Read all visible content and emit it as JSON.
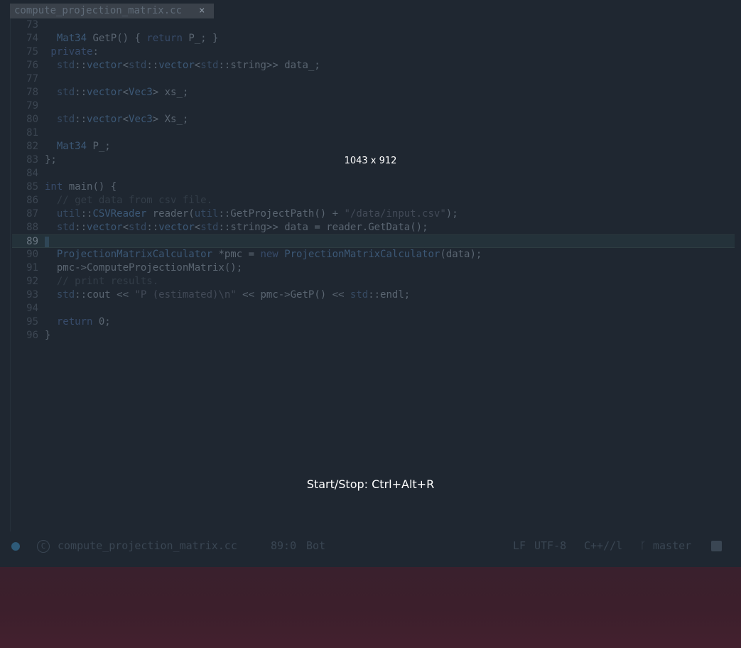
{
  "tab": {
    "title": "compute_projection_matrix.cc",
    "close": "×"
  },
  "overlay": {
    "dimensions": "1043 x 912",
    "hint": "Start/Stop: Ctrl+Alt+R"
  },
  "code_lines": [
    {
      "n": "73",
      "segs": []
    },
    {
      "n": "74",
      "segs": [
        [
          "t",
          "  "
        ],
        [
          "ty",
          "Mat34"
        ],
        [
          "t",
          " GetP() { "
        ],
        [
          "kw",
          "return"
        ],
        [
          "t",
          " P_; }"
        ]
      ]
    },
    {
      "n": "75",
      "segs": [
        [
          "kw",
          " private"
        ],
        [
          "t",
          ":"
        ]
      ]
    },
    {
      "n": "76",
      "segs": [
        [
          "t",
          "  "
        ],
        [
          "ns",
          "std"
        ],
        [
          "t",
          "::"
        ],
        [
          "ty",
          "vector"
        ],
        [
          "t",
          "<"
        ],
        [
          "ns",
          "std"
        ],
        [
          "t",
          "::"
        ],
        [
          "ty",
          "vector"
        ],
        [
          "t",
          "<"
        ],
        [
          "ns",
          "std"
        ],
        [
          "t",
          "::string>> data_;"
        ]
      ]
    },
    {
      "n": "77",
      "segs": []
    },
    {
      "n": "78",
      "segs": [
        [
          "t",
          "  "
        ],
        [
          "ns",
          "std"
        ],
        [
          "t",
          "::"
        ],
        [
          "ty",
          "vector"
        ],
        [
          "t",
          "<"
        ],
        [
          "ty",
          "Vec3"
        ],
        [
          "t",
          "> xs_;"
        ]
      ]
    },
    {
      "n": "79",
      "segs": []
    },
    {
      "n": "80",
      "segs": [
        [
          "t",
          "  "
        ],
        [
          "ns",
          "std"
        ],
        [
          "t",
          "::"
        ],
        [
          "ty",
          "vector"
        ],
        [
          "t",
          "<"
        ],
        [
          "ty",
          "Vec3"
        ],
        [
          "t",
          "> Xs_;"
        ]
      ]
    },
    {
      "n": "81",
      "segs": []
    },
    {
      "n": "82",
      "segs": [
        [
          "t",
          "  "
        ],
        [
          "ty",
          "Mat34"
        ],
        [
          "t",
          " P_;"
        ]
      ]
    },
    {
      "n": "83",
      "segs": [
        [
          "t",
          "};"
        ]
      ]
    },
    {
      "n": "84",
      "segs": []
    },
    {
      "n": "85",
      "segs": [
        [
          "kw",
          "int"
        ],
        [
          "t",
          " main() {"
        ]
      ]
    },
    {
      "n": "86",
      "segs": [
        [
          "cm",
          "  // get data from csv file."
        ]
      ]
    },
    {
      "n": "87",
      "segs": [
        [
          "t",
          "  "
        ],
        [
          "ns",
          "util"
        ],
        [
          "t",
          "::"
        ],
        [
          "ty",
          "CSVReader"
        ],
        [
          "t",
          " reader("
        ],
        [
          "ns",
          "util"
        ],
        [
          "t",
          "::GetProjectPath() + "
        ],
        [
          "str",
          "\"/data/input.csv\""
        ],
        [
          "t",
          ");"
        ]
      ]
    },
    {
      "n": "88",
      "segs": [
        [
          "t",
          "  "
        ],
        [
          "ns",
          "std"
        ],
        [
          "t",
          "::"
        ],
        [
          "ty",
          "vector"
        ],
        [
          "t",
          "<"
        ],
        [
          "ns",
          "std"
        ],
        [
          "t",
          "::"
        ],
        [
          "ty",
          "vector"
        ],
        [
          "t",
          "<"
        ],
        [
          "ns",
          "std"
        ],
        [
          "t",
          "::string>> data = reader.GetData();"
        ]
      ]
    },
    {
      "n": "89",
      "segs": [],
      "highlight": true
    },
    {
      "n": "90",
      "segs": [
        [
          "t",
          "  "
        ],
        [
          "ty",
          "ProjectionMatrixCalculator"
        ],
        [
          "t",
          " *pmc = "
        ],
        [
          "kw",
          "new"
        ],
        [
          "t",
          " "
        ],
        [
          "ty",
          "ProjectionMatrixCalculator"
        ],
        [
          "t",
          "(data);"
        ]
      ]
    },
    {
      "n": "91",
      "segs": [
        [
          "t",
          "  pmc->ComputeProjectionMatrix();"
        ]
      ]
    },
    {
      "n": "92",
      "segs": [
        [
          "cm",
          "  // print results."
        ]
      ]
    },
    {
      "n": "93",
      "segs": [
        [
          "t",
          "  "
        ],
        [
          "ns",
          "std"
        ],
        [
          "t",
          "::cout << "
        ],
        [
          "str",
          "\"P (estimated)\\n\""
        ],
        [
          "t",
          " << pmc->GetP() << "
        ],
        [
          "ns",
          "std"
        ],
        [
          "t",
          "::endl;"
        ]
      ]
    },
    {
      "n": "94",
      "segs": []
    },
    {
      "n": "95",
      "segs": [
        [
          "t",
          "  "
        ],
        [
          "kw",
          "return"
        ],
        [
          "t",
          " 0;"
        ]
      ]
    },
    {
      "n": "96",
      "segs": [
        [
          "t",
          "}"
        ]
      ]
    }
  ],
  "statusbar": {
    "filename": "compute_projection_matrix.cc",
    "position": "89:0",
    "scroll": "Bot",
    "line_ending": "LF",
    "encoding": "UTF-8",
    "mode": "C++//l",
    "branch": "master",
    "icons": [
      "status-dot-icon",
      "cpp-file-icon",
      "git-branch-icon",
      "lock-icon"
    ]
  }
}
